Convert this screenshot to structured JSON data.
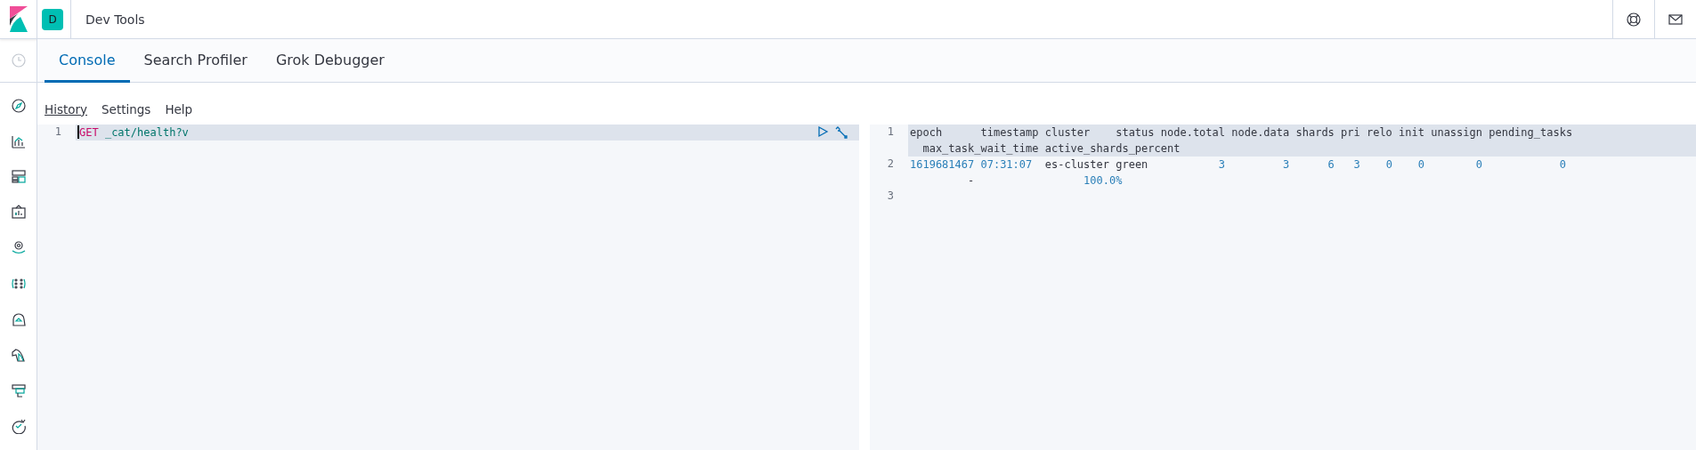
{
  "header": {
    "badge": "D",
    "title": "Dev Tools"
  },
  "tabs": [
    {
      "label": "Console",
      "selected": true
    },
    {
      "label": "Search Profiler",
      "selected": false
    },
    {
      "label": "Grok Debugger",
      "selected": false
    }
  ],
  "menu": [
    {
      "label": "History",
      "underlined": true
    },
    {
      "label": "Settings",
      "underlined": false
    },
    {
      "label": "Help",
      "underlined": false
    }
  ],
  "editor": {
    "lines": [
      {
        "number": "1",
        "active": true,
        "rows": [
          [
            {
              "text": "GET",
              "kind": "method"
            },
            {
              "text": " _cat/health?v",
              "kind": "url"
            }
          ]
        ]
      }
    ]
  },
  "output": {
    "lines": [
      {
        "number": "1",
        "active": true,
        "rows": [
          [
            {
              "text": "epoch      timestamp cluster    status node.total node.data shards pri relo init unassign pending_tasks",
              "kind": "plain"
            }
          ],
          [
            {
              "text": "  max_task_wait_time active_shards_percent",
              "kind": "plain"
            }
          ]
        ]
      },
      {
        "number": "2",
        "active": false,
        "rows": [
          [
            {
              "text": "1619681467 07:31:07",
              "kind": "number"
            },
            {
              "text": "  es-cluster green",
              "kind": "plain"
            },
            {
              "text": "           3         3      6   3    0    0        0            0",
              "kind": "number"
            }
          ],
          [
            {
              "text": "         -",
              "kind": "plain"
            },
            {
              "text": "                 100.0%",
              "kind": "number"
            }
          ]
        ]
      },
      {
        "number": "3",
        "active": false,
        "rows": [
          []
        ]
      }
    ]
  }
}
